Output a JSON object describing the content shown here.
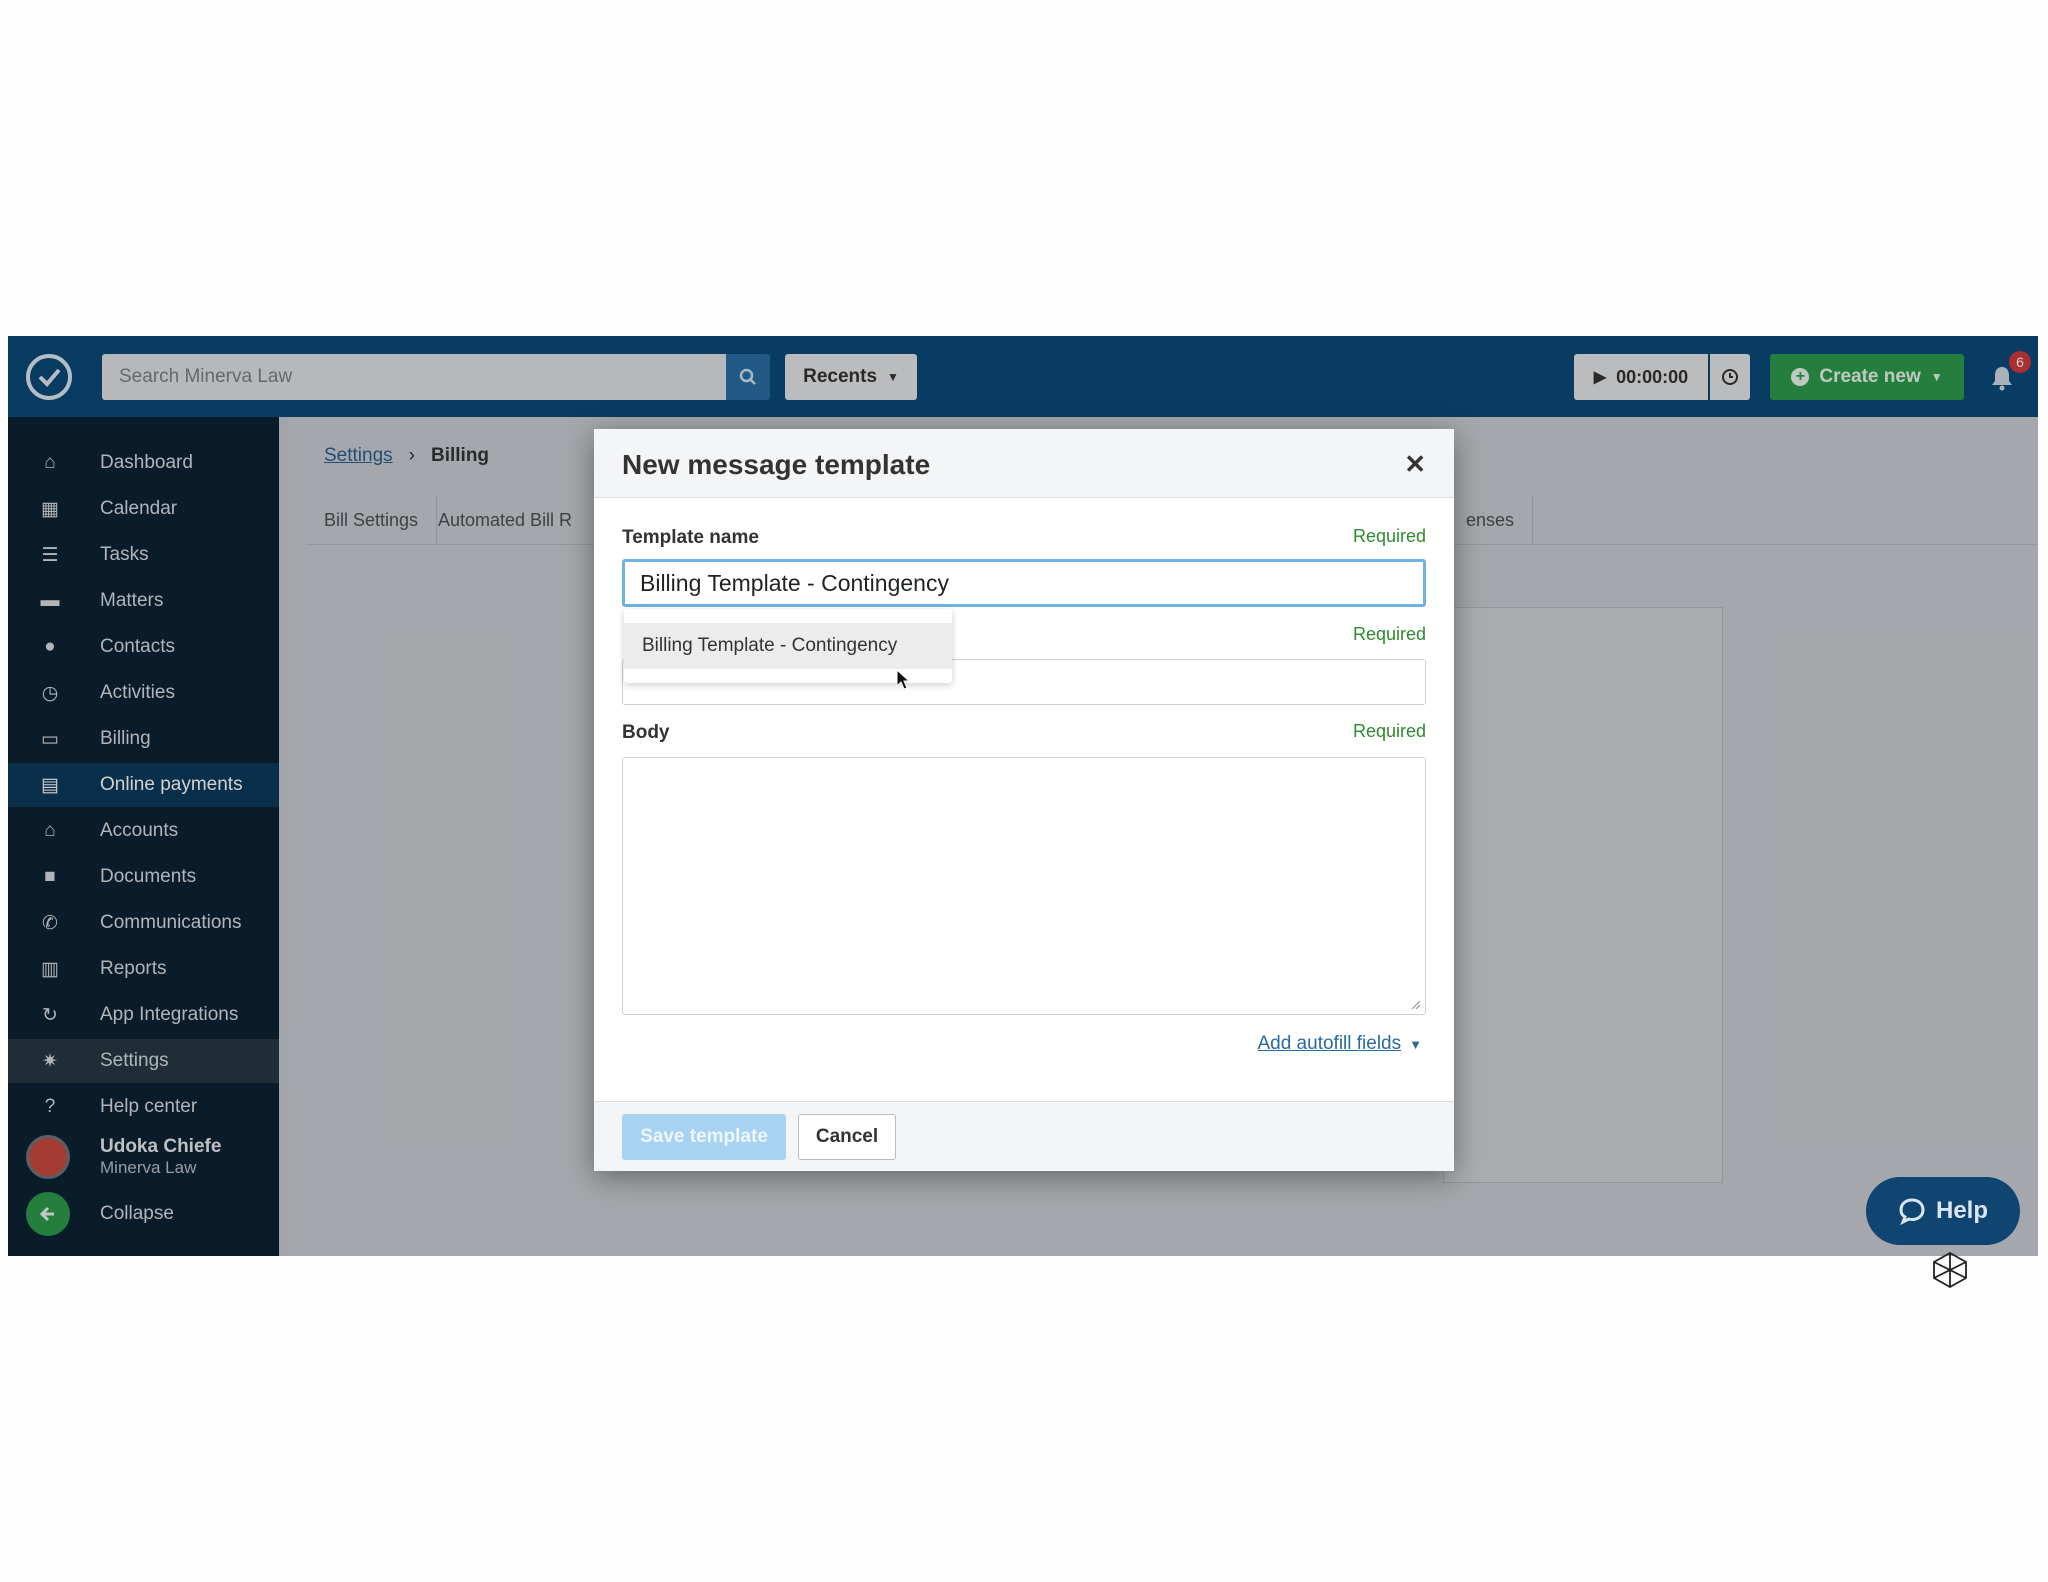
{
  "topbar": {
    "search_placeholder": "Search Minerva Law",
    "recents_label": "Recents",
    "timer_value": "00:00:00",
    "create_label": "Create new",
    "notification_count": "6",
    "brand_color": "#0a4a78",
    "accent_green": "#2d9b4e"
  },
  "sidebar": {
    "items": [
      {
        "label": "Dashboard",
        "icon": "home-icon"
      },
      {
        "label": "Calendar",
        "icon": "calendar-icon"
      },
      {
        "label": "Tasks",
        "icon": "list-icon"
      },
      {
        "label": "Matters",
        "icon": "briefcase-icon"
      },
      {
        "label": "Contacts",
        "icon": "person-icon"
      },
      {
        "label": "Activities",
        "icon": "clock-icon"
      },
      {
        "label": "Billing",
        "icon": "money-icon"
      },
      {
        "label": "Online payments",
        "icon": "credit-card-icon"
      },
      {
        "label": "Accounts",
        "icon": "bank-icon"
      },
      {
        "label": "Documents",
        "icon": "folder-icon"
      },
      {
        "label": "Communications",
        "icon": "phone-icon"
      },
      {
        "label": "Reports",
        "icon": "bar-chart-icon"
      },
      {
        "label": "App Integrations",
        "icon": "refresh-icon"
      },
      {
        "label": "Settings",
        "icon": "gear-icon"
      },
      {
        "label": "Help center",
        "icon": "question-icon"
      }
    ],
    "user_name": "Udoka Chiefe",
    "user_firm": "Minerva Law",
    "collapse_label": "Collapse"
  },
  "main": {
    "breadcrumb_parent": "Settings",
    "breadcrumb_separator": "›",
    "breadcrumb_current": "Billing",
    "tabs": [
      "Bill Settings",
      "Automated Bill R",
      "enses"
    ]
  },
  "modal": {
    "title": "New message template",
    "template_name_label": "Template name",
    "template_name_value": "Billing Template - Contingency",
    "required_label": "Required",
    "body_label": "Body",
    "autofill_label": "Add autofill fields",
    "save_label": "Save template",
    "cancel_label": "Cancel",
    "suggestion": "Billing Template - Contingency"
  },
  "help": {
    "label": "Help"
  }
}
